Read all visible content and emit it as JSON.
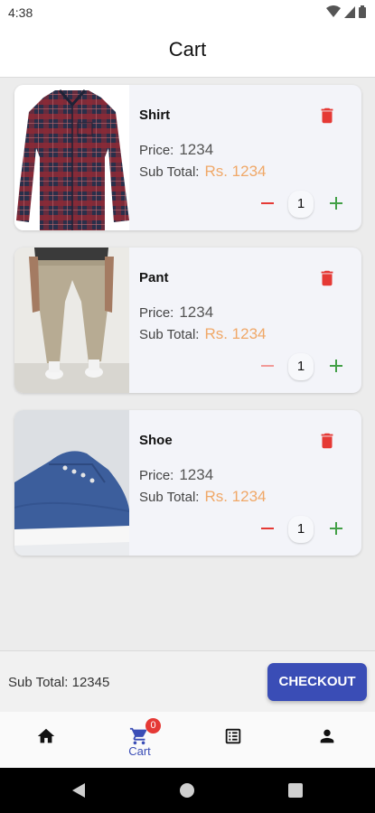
{
  "status_bar": {
    "time": "4:38"
  },
  "app_bar": {
    "title": "Cart"
  },
  "labels": {
    "price": "Price:",
    "sub_total": "Sub Total:"
  },
  "cart_items": [
    {
      "name": "Shirt",
      "price": "1234",
      "sub_total": "Rs. 1234",
      "quantity": "1",
      "image": "plaid-shirt"
    },
    {
      "name": "Pant",
      "price": "1234",
      "sub_total": "Rs. 1234",
      "quantity": "1",
      "image": "khaki-pants"
    },
    {
      "name": "Shoe",
      "price": "1234",
      "sub_total": "Rs. 1234",
      "quantity": "1",
      "image": "blue-sneaker"
    }
  ],
  "summary": {
    "sub_total_text": "Sub Total: 12345",
    "checkout_label": "CHECKOUT"
  },
  "bottom_nav": {
    "items": [
      {
        "icon": "home-icon",
        "label": ""
      },
      {
        "icon": "cart-icon",
        "label": "Cart",
        "badge": "0",
        "active": true
      },
      {
        "icon": "list-icon",
        "label": ""
      },
      {
        "icon": "person-icon",
        "label": ""
      }
    ]
  },
  "colors": {
    "accent": "#3a4db6",
    "delete": "#e53935",
    "minus": "#e53935",
    "plus": "#43a047",
    "subtotal_value": "#f0a868"
  }
}
